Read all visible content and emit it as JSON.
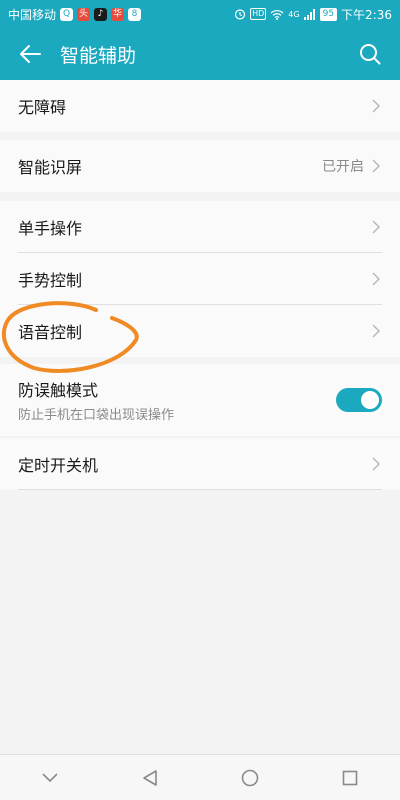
{
  "status_bar": {
    "carrier": "中国移动",
    "app_icon_1": "Q",
    "app_icon_2": "头",
    "app_icon_3": "♪",
    "app_icon_4": "华",
    "app_icon_5": "8",
    "hd": "HD",
    "network": "4G",
    "battery": "95",
    "time": "下午2:36"
  },
  "header": {
    "title": "智能辅助"
  },
  "items": {
    "accessibility": {
      "label": "无障碍"
    },
    "smart_screen": {
      "label": "智能识屏",
      "value": "已开启"
    },
    "one_hand": {
      "label": "单手操作"
    },
    "gesture": {
      "label": "手势控制"
    },
    "voice": {
      "label": "语音控制"
    },
    "pocket_mode": {
      "label": "防误触模式",
      "description": "防止手机在口袋出现误操作",
      "enabled": true
    },
    "scheduled_power": {
      "label": "定时开关机"
    }
  },
  "colors": {
    "accent": "#1ba9bf",
    "annotation": "#f08a24"
  }
}
